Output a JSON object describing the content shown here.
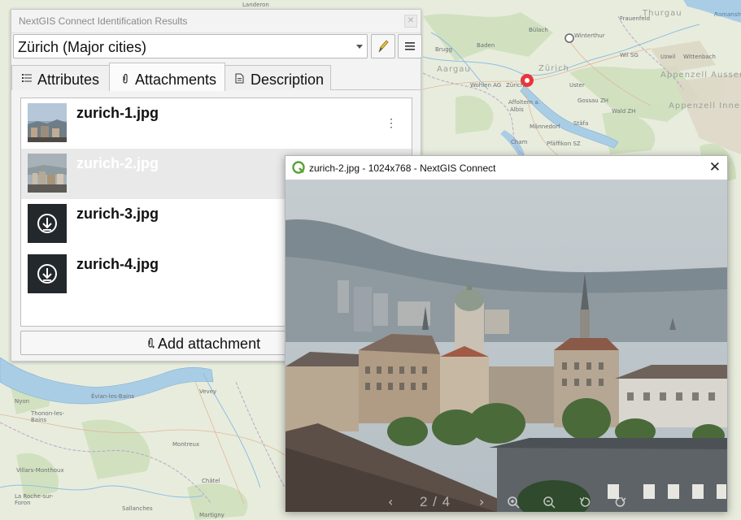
{
  "map": {
    "labels": {
      "bulach": "Bülach",
      "winterthur": "Winterthur",
      "zurich_region": "Zürich",
      "zurich_city": "Zürich",
      "baden": "Baden",
      "brugg": "Brugg",
      "aargau": "Aargau",
      "wohlen": "Wohlen AG",
      "affoltern": "Affoltern a.",
      "albis": "Albis",
      "uster": "Uster",
      "gossau": "Gossau ZH",
      "wald": "Wald ZH",
      "thurgau": "Thurgau",
      "frauenfeld": "Frauenfeld",
      "wil": "Wil SG",
      "uzwil": "Uzwil",
      "wittenbach": "Wittenbach",
      "romanshorn": "Romansho",
      "appenzell_a": "Appenzell Ausserrh",
      "appenzell_i": "Appenzell Innerr",
      "mannedorf": "Männedorf",
      "stafa": "Stäfa",
      "cham": "Cham",
      "pfaffikon": "Pfäffikon SZ",
      "nyon": "Nyon",
      "evian": "Évian-les-Bains",
      "thonon": "Thonon-les-\nBains",
      "montreux": "Montreux",
      "vevey": "Vevey",
      "chatel": "Châtel",
      "martigny": "Martigny",
      "roche": "La Roche-sur-\nForon",
      "sallanches": "Sallanches",
      "villars": "Villars-Monthoux",
      "landeron": "Landeron"
    }
  },
  "panel": {
    "title": "NextGIS Connect Identification Results",
    "close_icon": "close-icon",
    "feature_combo_value": "Zürich (Major cities)",
    "edit_icon": "pencil-icon",
    "menu_icon": "hamburger-icon",
    "tabs": [
      {
        "label": "Attributes",
        "icon": "list-icon",
        "active": false
      },
      {
        "label": "Attachments",
        "icon": "paperclip-icon",
        "active": true
      },
      {
        "label": "Description",
        "icon": "document-icon",
        "active": false
      }
    ],
    "attachments": [
      {
        "name": "zurich-1.jpg",
        "thumb": "photo",
        "selected": false
      },
      {
        "name": "zurich-2.jpg",
        "thumb": "photo",
        "selected": true
      },
      {
        "name": "zurich-3.jpg",
        "thumb": "download",
        "selected": false
      },
      {
        "name": "zurich-4.jpg",
        "thumb": "download",
        "selected": false
      }
    ],
    "add_attachment_label": "Add attachment"
  },
  "viewer": {
    "title": "zurich-2.jpg - 1024x768 - NextGIS Connect",
    "page_counter": "2 / 4",
    "controls": [
      "prev-icon",
      "next-icon",
      "zoom-in-icon",
      "zoom-out-icon",
      "rotate-left-icon",
      "rotate-right-icon"
    ]
  },
  "colors": {
    "accent_marker": "#e8232a",
    "viewer_icon": "#5aa23a"
  }
}
